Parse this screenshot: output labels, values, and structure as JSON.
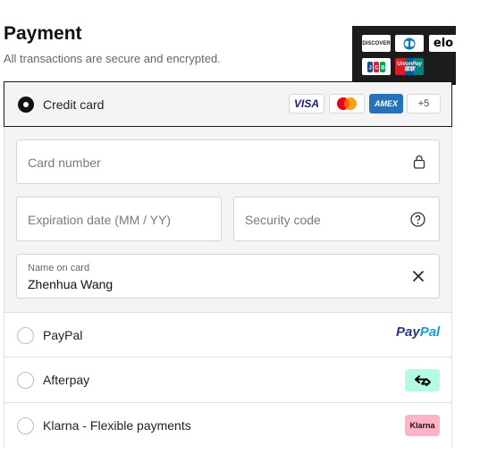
{
  "header": {
    "title": "Payment",
    "subtitle": "All transactions are secure and encrypted."
  },
  "more_brands": {
    "items": [
      {
        "name": "discover-logo",
        "text": "DISCOVER"
      },
      {
        "name": "diners-club-logo",
        "text": ""
      },
      {
        "name": "elo-logo",
        "text": "elo"
      },
      {
        "name": "jcb-logo",
        "text": ""
      },
      {
        "name": "unionpay-logo",
        "text": "UnionPay 银联"
      }
    ]
  },
  "methods": {
    "credit_card": {
      "label": "Credit card",
      "brands": {
        "visa": "VISA",
        "amex": "AMEX",
        "more": "+5"
      },
      "selected": true
    },
    "form": {
      "card_number_placeholder": "Card number",
      "expiration_placeholder": "Expiration date (MM / YY)",
      "security_code_placeholder": "Security code",
      "name_label": "Name on card",
      "name_value": "Zhenhua Wang"
    },
    "paypal": {
      "label": "PayPal",
      "logo_part1": "Pay",
      "logo_part2": "Pal"
    },
    "afterpay": {
      "label": "Afterpay"
    },
    "klarna": {
      "label": "Klarna - Flexible payments",
      "logo_text": "Klarna"
    }
  },
  "colors": {
    "accent": "#111111",
    "form_bg": "#f4f4f4",
    "afterpay_mint": "#b2fce4",
    "klarna_pink": "#ffb3c7",
    "paypal_dark": "#253b80",
    "paypal_light": "#179bd7",
    "amex_blue": "#2671b9"
  }
}
